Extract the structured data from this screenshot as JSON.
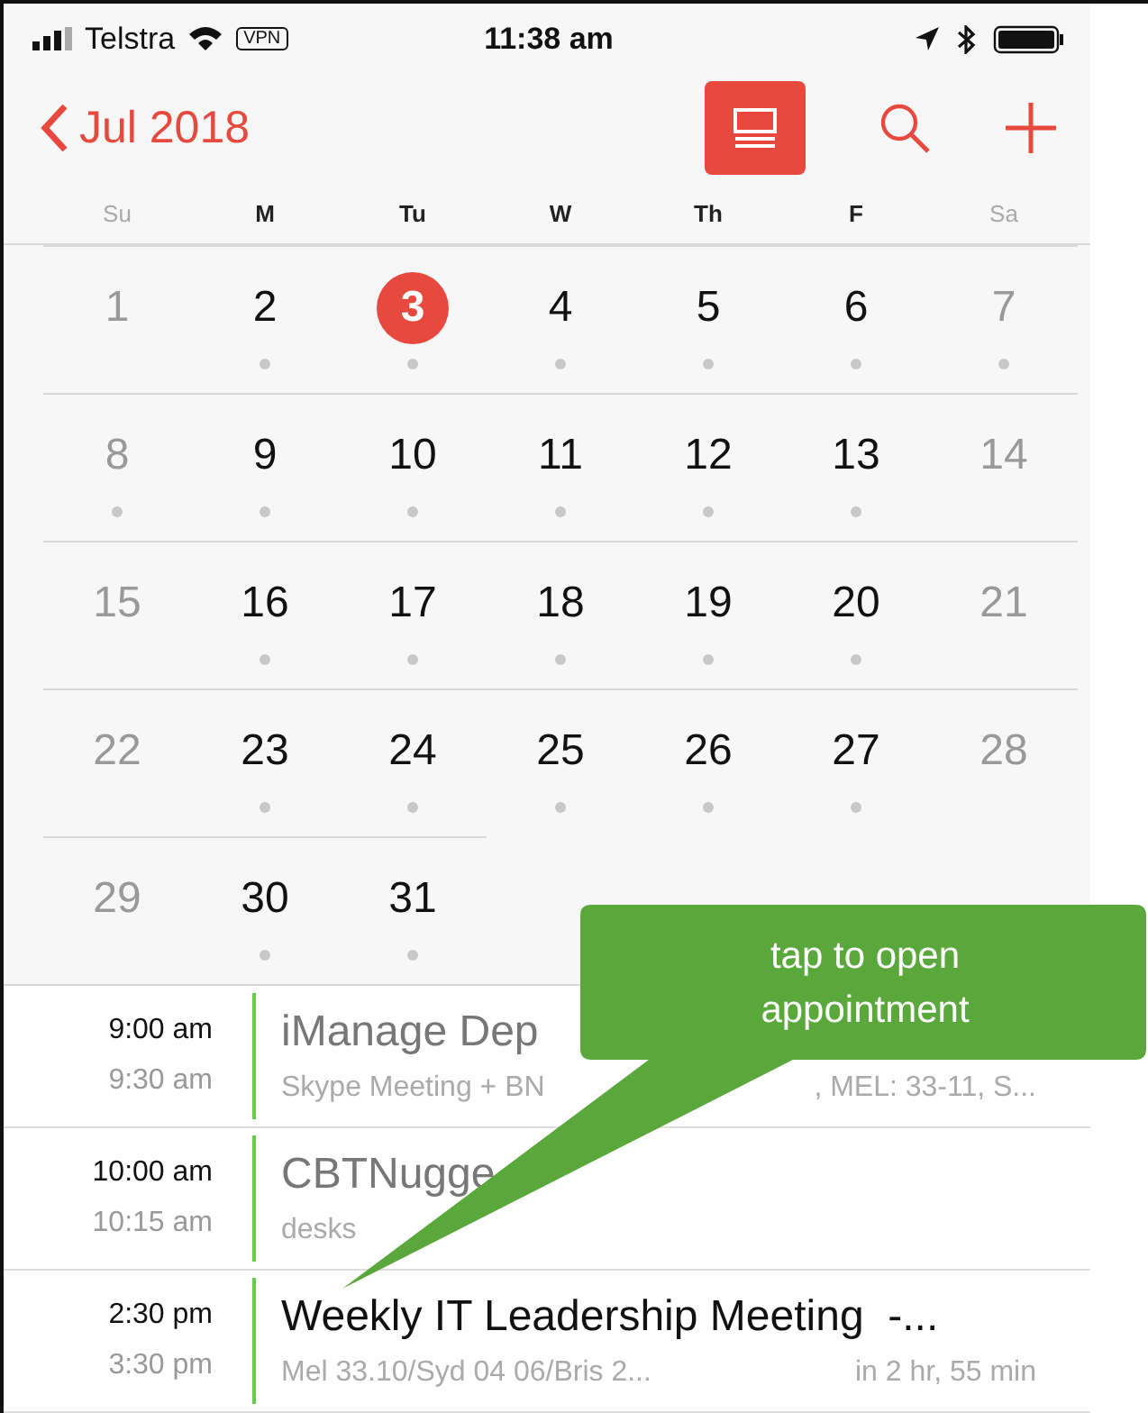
{
  "status_bar": {
    "carrier": "Telstra",
    "vpn": "VPN",
    "time": "11:38 am"
  },
  "nav": {
    "back": "Jul 2018",
    "list_view_on": true
  },
  "weekdays": [
    {
      "label": "Su",
      "weekend": true
    },
    {
      "label": "M",
      "weekend": false
    },
    {
      "label": "Tu",
      "weekend": false
    },
    {
      "label": "W",
      "weekend": false
    },
    {
      "label": "Th",
      "weekend": false
    },
    {
      "label": "F",
      "weekend": false
    },
    {
      "label": "Sa",
      "weekend": true
    }
  ],
  "weeks": [
    [
      {
        "day": "1",
        "weekend": true,
        "selected": false,
        "has_events": false
      },
      {
        "day": "2",
        "weekend": false,
        "selected": false,
        "has_events": true
      },
      {
        "day": "3",
        "weekend": false,
        "selected": true,
        "has_events": true
      },
      {
        "day": "4",
        "weekend": false,
        "selected": false,
        "has_events": true
      },
      {
        "day": "5",
        "weekend": false,
        "selected": false,
        "has_events": true
      },
      {
        "day": "6",
        "weekend": false,
        "selected": false,
        "has_events": true
      },
      {
        "day": "7",
        "weekend": true,
        "selected": false,
        "has_events": true
      }
    ],
    [
      {
        "day": "8",
        "weekend": true,
        "selected": false,
        "has_events": true
      },
      {
        "day": "9",
        "weekend": false,
        "selected": false,
        "has_events": true
      },
      {
        "day": "10",
        "weekend": false,
        "selected": false,
        "has_events": true
      },
      {
        "day": "11",
        "weekend": false,
        "selected": false,
        "has_events": true
      },
      {
        "day": "12",
        "weekend": false,
        "selected": false,
        "has_events": true
      },
      {
        "day": "13",
        "weekend": false,
        "selected": false,
        "has_events": true
      },
      {
        "day": "14",
        "weekend": true,
        "selected": false,
        "has_events": false
      }
    ],
    [
      {
        "day": "15",
        "weekend": true,
        "selected": false,
        "has_events": false
      },
      {
        "day": "16",
        "weekend": false,
        "selected": false,
        "has_events": true
      },
      {
        "day": "17",
        "weekend": false,
        "selected": false,
        "has_events": true
      },
      {
        "day": "18",
        "weekend": false,
        "selected": false,
        "has_events": true
      },
      {
        "day": "19",
        "weekend": false,
        "selected": false,
        "has_events": true
      },
      {
        "day": "20",
        "weekend": false,
        "selected": false,
        "has_events": true
      },
      {
        "day": "21",
        "weekend": true,
        "selected": false,
        "has_events": false
      }
    ],
    [
      {
        "day": "22",
        "weekend": true,
        "selected": false,
        "has_events": false
      },
      {
        "day": "23",
        "weekend": false,
        "selected": false,
        "has_events": true
      },
      {
        "day": "24",
        "weekend": false,
        "selected": false,
        "has_events": true
      },
      {
        "day": "25",
        "weekend": false,
        "selected": false,
        "has_events": true
      },
      {
        "day": "26",
        "weekend": false,
        "selected": false,
        "has_events": true
      },
      {
        "day": "27",
        "weekend": false,
        "selected": false,
        "has_events": true
      },
      {
        "day": "28",
        "weekend": true,
        "selected": false,
        "has_events": false
      }
    ],
    [
      {
        "day": "29",
        "weekend": true,
        "selected": false,
        "has_events": false
      },
      {
        "day": "30",
        "weekend": false,
        "selected": false,
        "has_events": true
      },
      {
        "day": "31",
        "weekend": false,
        "selected": false,
        "has_events": true
      }
    ]
  ],
  "events": [
    {
      "start": "9:00 am",
      "end": "9:30 am",
      "title": "iManage Dep",
      "detail": "Skype Meeting + BN",
      "aside": ", MEL: 33-11, S...",
      "past": true
    },
    {
      "start": "10:00 am",
      "end": "10:15 am",
      "title": "CBTNugge",
      "detail": "desks",
      "past": true
    },
    {
      "start": "2:30 pm",
      "end": "3:30 pm",
      "title": "Weekly IT Leadership Meeting  -...",
      "detail": "Mel 33.10/Syd 04 06/Bris 2...",
      "aside": "in 2 hr, 55 min",
      "past": false
    }
  ],
  "callout": "tap to open appointment"
}
